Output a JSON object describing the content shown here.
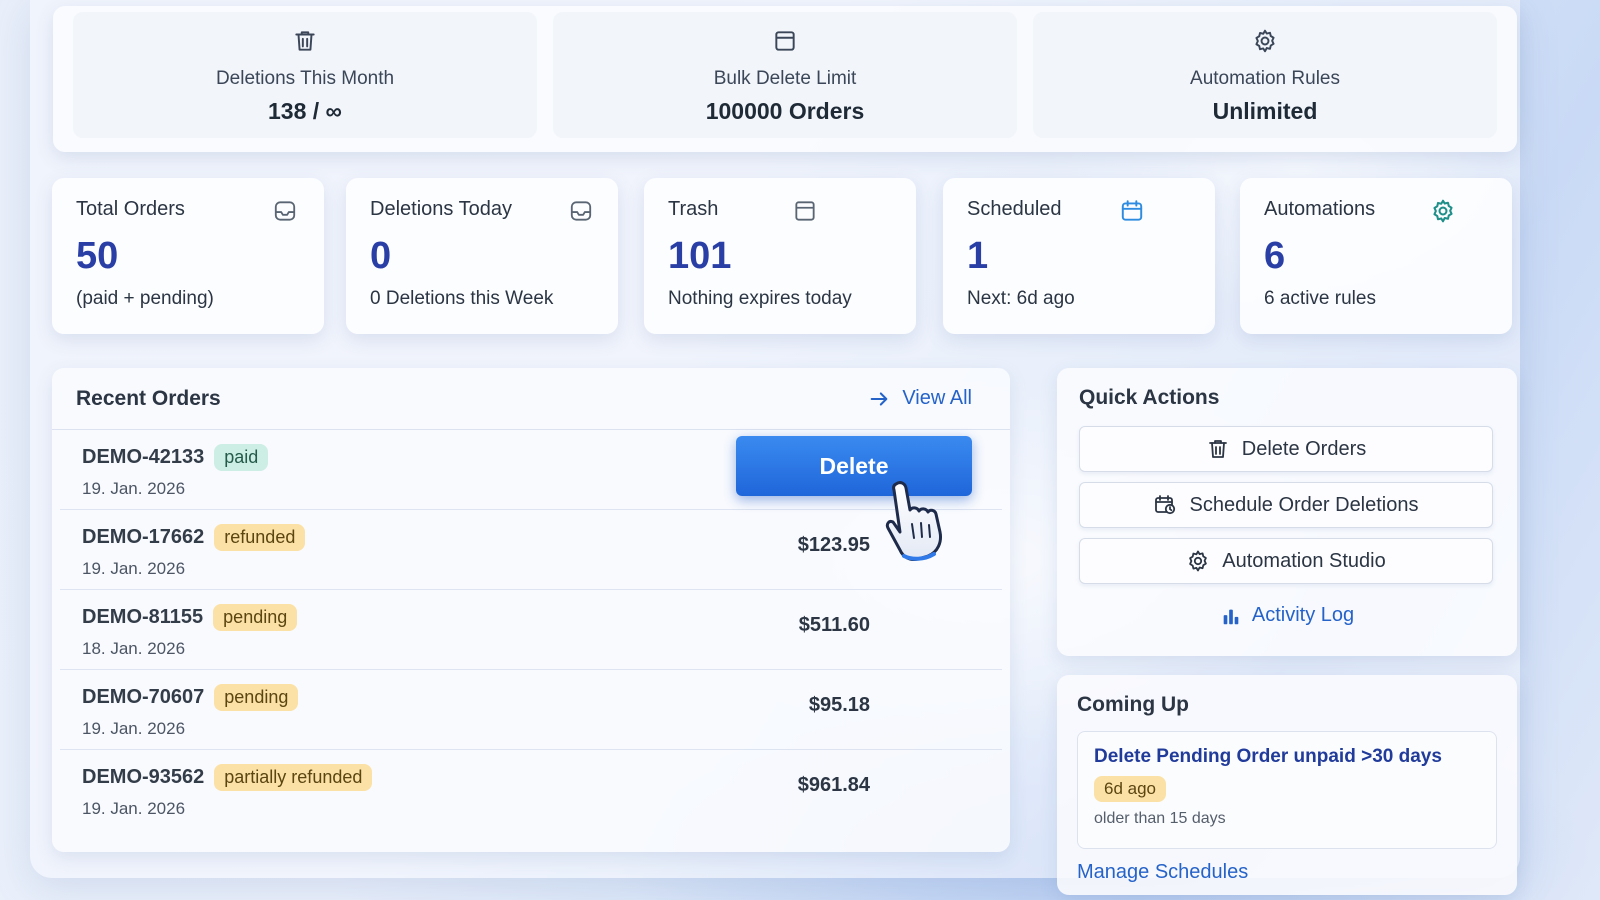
{
  "summary": [
    {
      "icon": "trash-icon",
      "label": "Deletions This Month",
      "value": "138 / ∞"
    },
    {
      "icon": "box-icon",
      "label": "Bulk Delete Limit",
      "value": "100000 Orders"
    },
    {
      "icon": "gear-icon",
      "label": "Automation Rules",
      "value": "Unlimited"
    }
  ],
  "stats": [
    {
      "title": "Total Orders",
      "icon": "inbox-icon",
      "value": "50",
      "sub": "(paid + pending)"
    },
    {
      "title": "Deletions Today",
      "icon": "inbox-icon",
      "value": "0",
      "sub": "0 Deletions this Week"
    },
    {
      "title": "Trash",
      "icon": "box-icon",
      "value": "101",
      "sub": "Nothing expires today"
    },
    {
      "title": "Scheduled",
      "icon": "calendar-icon",
      "value": "1",
      "sub": "Next: 6d ago"
    },
    {
      "title": "Automations",
      "icon": "gear-icon",
      "value": "6",
      "sub": "6 active rules"
    }
  ],
  "orders": {
    "title": "Recent Orders",
    "view_all": "View All",
    "delete_label": "Delete",
    "rows": [
      {
        "id": "DEMO-42133",
        "status": "paid",
        "date": "19. Jan. 2026",
        "amount": ""
      },
      {
        "id": "DEMO-17662",
        "status": "refunded",
        "date": "19. Jan. 2026",
        "amount": "$123.95"
      },
      {
        "id": "DEMO-81155",
        "status": "pending",
        "date": "18. Jan. 2026",
        "amount": "$511.60"
      },
      {
        "id": "DEMO-70607",
        "status": "pending",
        "date": "19. Jan. 2026",
        "amount": "$95.18"
      },
      {
        "id": "DEMO-93562",
        "status": "partially refunded",
        "date": "19. Jan. 2026",
        "amount": "$961.84"
      }
    ]
  },
  "quick_actions": {
    "title": "Quick Actions",
    "buttons": [
      {
        "label": "Delete Orders",
        "icon": "trash-icon"
      },
      {
        "label": "Schedule Order Deletions",
        "icon": "calendar-clock-icon"
      },
      {
        "label": "Automation Studio",
        "icon": "gear-icon"
      }
    ],
    "activity_log": "Activity Log"
  },
  "coming_up": {
    "title": "Coming Up",
    "item_title": "Delete Pending Order unpaid >30 days",
    "item_badge": "6d ago",
    "item_sub": "older than 15 days",
    "manage": "Manage Schedules"
  },
  "colors": {
    "accent": "#2563c9",
    "stat_value": "#2a3fa6",
    "badge_paid": "#cdeee4",
    "badge_warn": "#fbe1a6",
    "delete_button": "#2f7ae8"
  }
}
